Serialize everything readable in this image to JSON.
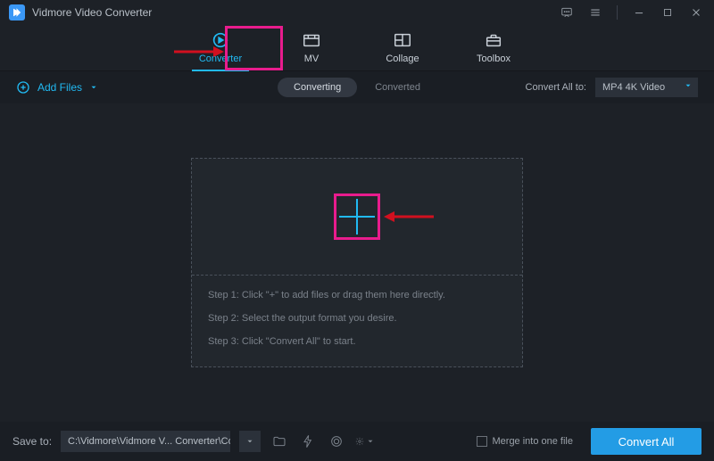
{
  "app": {
    "title": "Vidmore Video Converter"
  },
  "tabs": {
    "converter": "Converter",
    "mv": "MV",
    "collage": "Collage",
    "toolbox": "Toolbox"
  },
  "subbar": {
    "add_files": "Add Files",
    "status_converting": "Converting",
    "status_converted": "Converted",
    "convert_all_to": "Convert All to:",
    "format": "MP4 4K Video"
  },
  "dropzone": {
    "step1": "Step 1: Click \"+\" to add files or drag them here directly.",
    "step2": "Step 2: Select the output format you desire.",
    "step3": "Step 3: Click \"Convert All\" to start."
  },
  "bottom": {
    "save_to": "Save to:",
    "path": "C:\\Vidmore\\Vidmore V... Converter\\Converted",
    "merge": "Merge into one file",
    "convert_all": "Convert All"
  }
}
